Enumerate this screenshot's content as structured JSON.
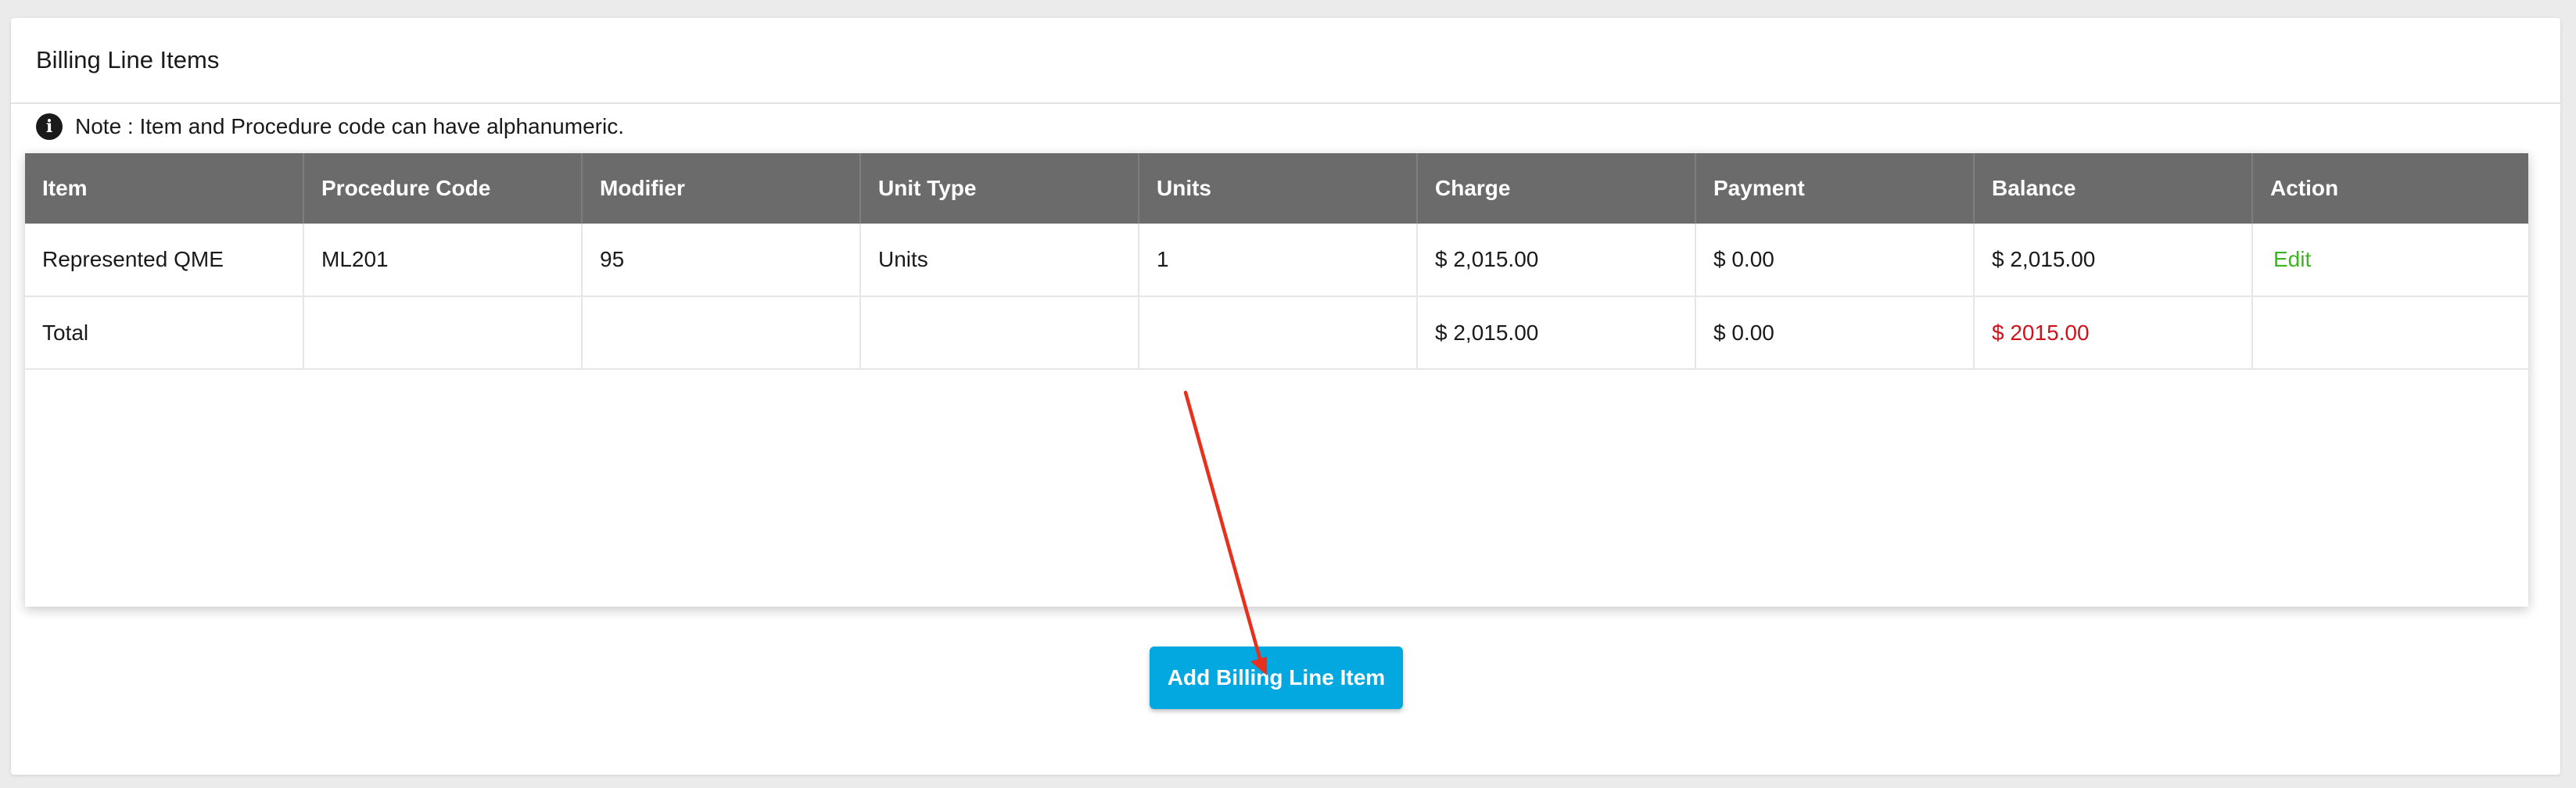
{
  "panel": {
    "title": "Billing Line Items",
    "note": "Note : Item and Procedure code can have alphanumeric."
  },
  "table": {
    "headers": [
      "Item",
      "Procedure Code",
      "Modifier",
      "Unit Type",
      "Units",
      "Charge",
      "Payment",
      "Balance",
      "Action"
    ],
    "rows": [
      {
        "item": "Represented QME",
        "procedure_code": "ML201",
        "modifier": "95",
        "unit_type": "Units",
        "units": "1",
        "charge": "$ 2,015.00",
        "payment": "$ 0.00",
        "balance": "$ 2,015.00",
        "action": "Edit"
      }
    ],
    "total": {
      "label": "Total",
      "charge": "$ 2,015.00",
      "payment": "$ 0.00",
      "balance": "$ 2015.00"
    }
  },
  "add_button_label": "Add Billing Line Item",
  "colors": {
    "header_bg": "#6b6b6b",
    "button_bg": "#04a8e0",
    "edit_link": "#3cb521",
    "balance_due": "#d0121b",
    "annotation_arrow": "#e8301c"
  },
  "icons": {
    "note_icon": "info-icon",
    "annotation": "red-arrow"
  }
}
